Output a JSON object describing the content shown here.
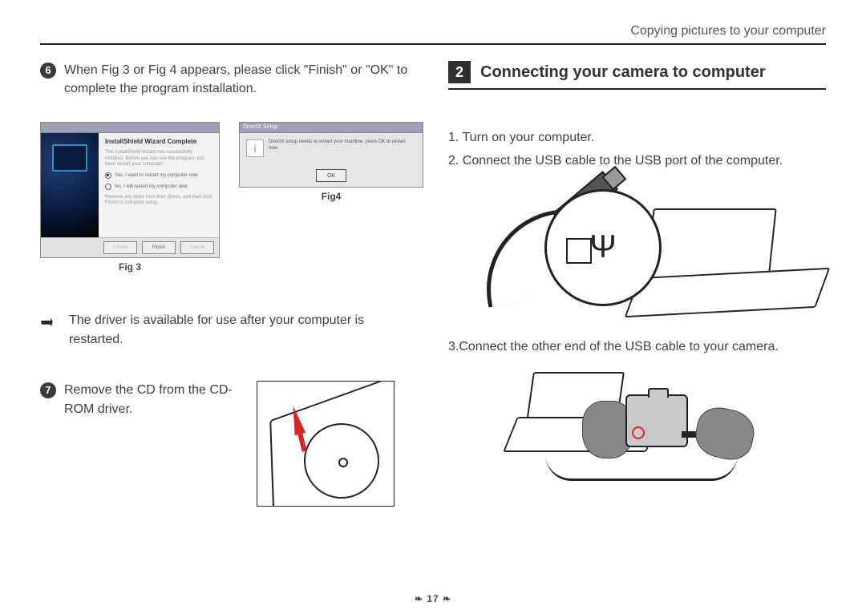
{
  "running_head": "Copying pictures to your computer",
  "left": {
    "step6_badge": "6",
    "step6_text": "When Fig 3 or Fig 4 appears, please click \"Finish\" or \"OK\" to complete the program installation.",
    "fig3": {
      "label": "Fig 3",
      "heading": "InstallShield Wizard Complete",
      "blurb": "The InstallShield wizard has successfully installed. Before you can use the program, you must restart your computer.",
      "radio_yes": "Yes, I want to restart my computer now.",
      "radio_no": "No, I will restart my computer later.",
      "hint": "Remove any disks from their drives, and then click Finish to complete setup.",
      "btn_back": "< Back",
      "btn_finish": "Finish",
      "btn_cancel": "Cancel"
    },
    "fig4": {
      "label": "Fig4",
      "title": "DirectX Setup",
      "message": "DirectX setup needs to restart your machine, press OK to restart now.",
      "btn_ok": "OK"
    },
    "note": "The driver is available for use after your computer is restarted.",
    "step7_badge": "7",
    "step7_text": "Remove the CD from the CD-ROM driver."
  },
  "right": {
    "section_number": "2",
    "section_title": "Connecting your camera to computer",
    "step1": "1. Turn on your computer.",
    "step2": "2. Connect the USB cable to the USB port of the computer.",
    "step3": "3.Connect the other end of the USB cable to your camera.",
    "usb_symbol": "Ψ"
  },
  "page_number": "17",
  "page_deco_left": "❧",
  "page_deco_right": "❧"
}
